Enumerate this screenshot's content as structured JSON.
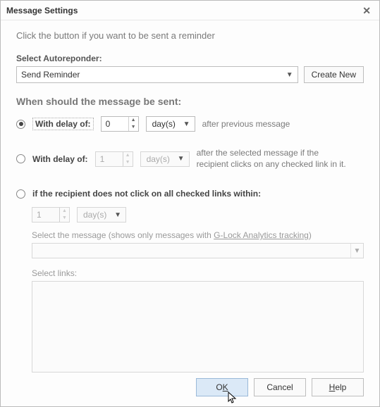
{
  "titlebar": {
    "title": "Message Settings"
  },
  "subtitle": "Click the button if you want to be sent a reminder",
  "autoresponder": {
    "label": "Select Autoreponder:",
    "selected": "Send Reminder",
    "create_label": "Create New"
  },
  "section_title": "When should the message be sent:",
  "option1": {
    "label": "With delay of:",
    "value": "0",
    "unit": "day(s)",
    "after": "after previous message"
  },
  "option2": {
    "label": "With delay of:",
    "value": "1",
    "unit": "day(s)",
    "after": "after the selected message if the recipient clicks on any checked link in it."
  },
  "option3": {
    "label": "if the recipient does not click on all checked links within:",
    "value": "1",
    "unit": "day(s)",
    "msg_label_pre": "Select the message (shows only messages with ",
    "msg_label_link": "G-Lock Analytics tracking",
    "msg_label_post": ")",
    "links_label": "Select links:"
  },
  "buttons": {
    "ok_pre": "O",
    "ok_u": "K",
    "cancel": "Cancel",
    "help_u": "H",
    "help_post": "elp"
  }
}
